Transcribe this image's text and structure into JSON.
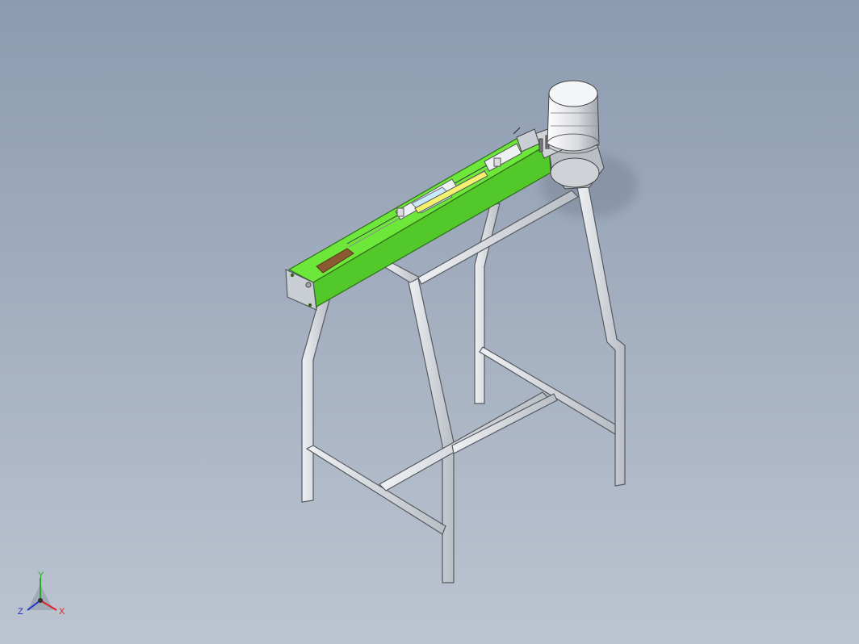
{
  "viewport": {
    "background_top": "#8c9bb0",
    "background_bottom": "#bcc4d0"
  },
  "model": {
    "frame_color": "#d7dbe0",
    "frame_edge": "#555a60",
    "conveyor_color": "#63e033",
    "conveyor_edge": "#2f6e18",
    "motor_color": "#e6e8ec",
    "pad_color": "#8a5a32"
  },
  "triad": {
    "y_label": "Y",
    "x_label": "X",
    "z_label": "Z",
    "y_color": "#22aa22",
    "x_color": "#dd2222",
    "z_color": "#2233cc"
  }
}
